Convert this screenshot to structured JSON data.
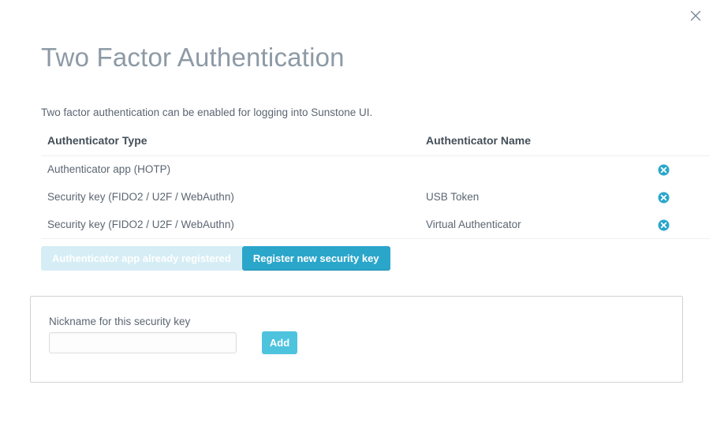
{
  "window": {
    "close_label": "×",
    "close_icon": "close-icon"
  },
  "header": {
    "title": "Two Factor Authentication",
    "description": "Two factor authentication can be enabled for logging into Sunstone UI."
  },
  "table": {
    "columns": [
      "Authenticator Type",
      "Authenticator Name",
      ""
    ],
    "rows": [
      {
        "type": "Authenticator app (HOTP)",
        "name": "",
        "delete_icon": "delete-circle-icon"
      },
      {
        "type": "Security key (FIDO2 / U2F / WebAuthn)",
        "name": "USB Token",
        "delete_icon": "delete-circle-icon"
      },
      {
        "type": "Security key (FIDO2 / U2F / WebAuthn)",
        "name": "Virtual Authenticator",
        "delete_icon": "delete-circle-icon"
      }
    ]
  },
  "actions": {
    "authenticator_app_label": "Authenticator app already registered",
    "register_security_key_label": "Register new security key"
  },
  "register_form": {
    "nickname_label": "Nickname for this security key",
    "nickname_value": "",
    "nickname_placeholder": "",
    "add_label": "Add"
  },
  "colors": {
    "accent": "#2ba6cb",
    "accent_light": "#4ec3dd",
    "accent_disabled": "#d6edf5",
    "title": "#8d9aa6",
    "text": "#5b6672",
    "heading": "#444e57",
    "border": "#eceff1",
    "panel_border": "#cfd3d6"
  }
}
